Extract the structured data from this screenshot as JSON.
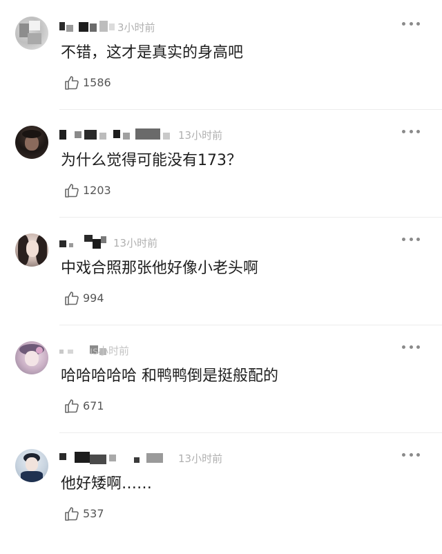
{
  "comments": [
    {
      "time": "13小时前",
      "time_visible": "3小时前",
      "text": "不错，这才是真实的身高吧",
      "likes": "1586"
    },
    {
      "time": "13小时前",
      "text": "为什么觉得可能没有173？",
      "likes": "1203"
    },
    {
      "time": "13小时前",
      "text": "中戏合照那张他好像小老头啊",
      "likes": "994"
    },
    {
      "time": "13小时前",
      "time_visible": "ıs小时前",
      "text": "哈哈哈哈哈 和鸭鸭倒是挺般配的",
      "likes": "671"
    },
    {
      "time": "13小时前",
      "text": "他好矮啊……",
      "likes": "537"
    }
  ],
  "icons": {
    "like": "thumbs-up-icon",
    "more": "more-dots-icon"
  },
  "colors": {
    "text": "#1e1e1e",
    "time": "#b0b0b0",
    "like": "#555555",
    "divider": "#ececec"
  }
}
